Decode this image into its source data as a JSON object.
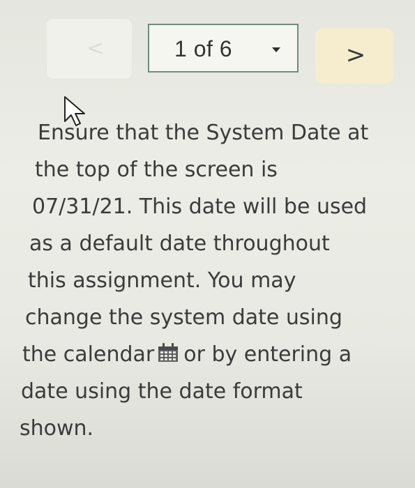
{
  "pager": {
    "prev_icon": "chevron-left-icon",
    "selected_page": "1 of 6",
    "next_label": ">",
    "next_icon": "chevron-right-icon",
    "next_bg": "#f5edce"
  },
  "instructions": {
    "line_1": "Ensure that the System Date at",
    "line_2": "the top of the screen is",
    "line_3": "07/31/21. This date will be used",
    "line_4": "as a default date throughout",
    "line_5": "this assignment. You may",
    "line_6": "change the system date using",
    "line_7_before": "the calendar",
    "line_7_icon": "calendar-icon",
    "line_7_after": "or by entering a",
    "line_8": "date using the date format",
    "line_9": "shown."
  }
}
